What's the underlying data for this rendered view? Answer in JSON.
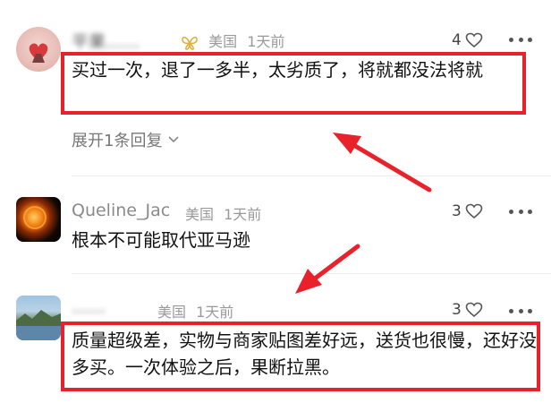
{
  "comments": [
    {
      "username": "平果……",
      "badge_icon": "butterfly-badge-icon",
      "location": "美国",
      "time": "1天前",
      "likes": "4",
      "text": "买过一次，退了一多半，太劣质了，将就都没法将就",
      "reply_label": "展开1条回复"
    },
    {
      "username": "Queline_Jac",
      "location": "美国",
      "time": "1天前",
      "likes": "3",
      "text": "根本不可能取代亚马逊"
    },
    {
      "username": "……",
      "location": "美国",
      "time": "1天前",
      "likes": "3",
      "text": "质量超级差，实物与商家贴图差好远，送货也很慢，还好没多买。一次体验之后，果断拉黑。"
    }
  ],
  "colors": {
    "highlight": "#e8212a",
    "meta": "#9a9a9a",
    "text": "#111111"
  }
}
